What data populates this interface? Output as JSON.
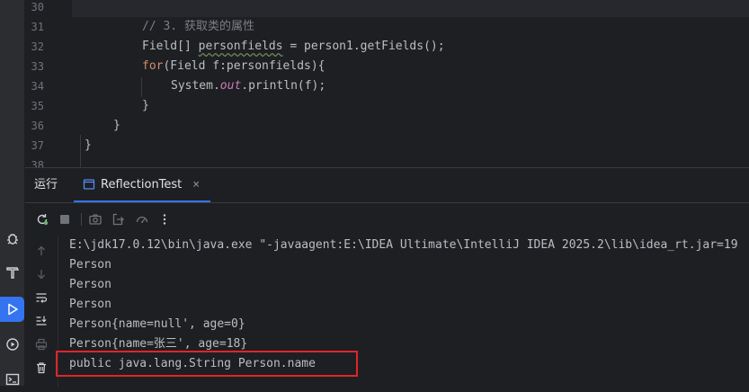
{
  "editor": {
    "lines": [
      {
        "num": "30",
        "text": ""
      },
      {
        "num": "31",
        "text": "// 3. 获取类的属性"
      },
      {
        "num": "32",
        "text": "Field[] personfields = person1.getFields();"
      },
      {
        "num": "33",
        "text": "for(Field f:personfields){"
      },
      {
        "num": "34",
        "text": "System.out.println(f);"
      },
      {
        "num": "35",
        "text": "}"
      },
      {
        "num": "36",
        "text": "}"
      },
      {
        "num": "37",
        "text": "}"
      },
      {
        "num": "38",
        "text": ""
      }
    ]
  },
  "run_window": {
    "title": "运行",
    "tab": {
      "label": "ReflectionTest",
      "close": "×"
    },
    "console": [
      "E:\\jdk17.0.12\\bin\\java.exe \"-javaagent:E:\\IDEA Ultimate\\IntelliJ IDEA 2025.2\\lib\\idea_rt.jar=19",
      "Person",
      "Person",
      "Person",
      "Person{name=null', age=0}",
      "Person{name=张三', age=18}",
      "public java.lang.String Person.name"
    ]
  },
  "colors": {
    "accent": "#3574f0",
    "highlight": "#e0252b",
    "keyword": "#cf8e6d",
    "comment": "#7a7e85",
    "static_field": "#c77dbb"
  },
  "icons": {
    "left_strip": [
      "bug-icon",
      "build-hammer-icon",
      "run-icon",
      "services-icon",
      "terminal-icon"
    ],
    "toolbar": [
      "rerun-icon",
      "stop-icon",
      "camera-icon",
      "export-icon",
      "coverage-gauge-icon",
      "more-icon"
    ],
    "console_gutter": [
      "arrow-up-icon",
      "arrow-down-icon",
      "soft-wrap-icon",
      "scroll-to-end-icon",
      "print-icon",
      "trash-icon"
    ]
  }
}
